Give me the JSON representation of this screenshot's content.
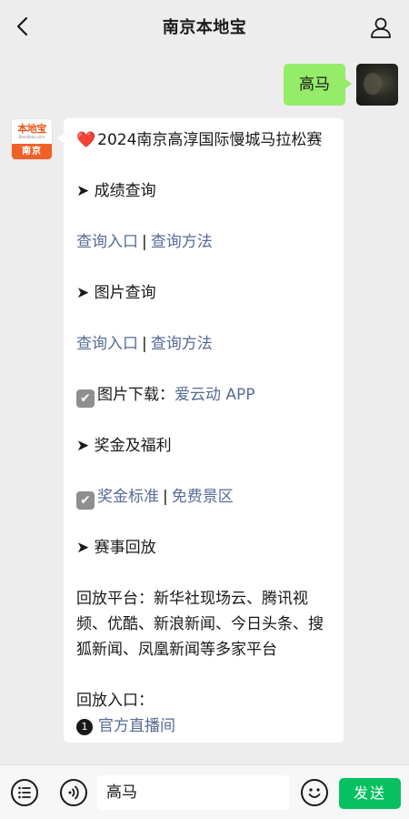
{
  "header": {
    "title": "南京本地宝",
    "back_icon": "chevron-left-icon",
    "user_icon": "person-icon"
  },
  "chat": {
    "outgoing": {
      "text": "高马"
    },
    "bot_avatar": {
      "logo": "本地宝",
      "url": "Bendibao.com",
      "city": "南京"
    },
    "incoming": {
      "title": "2024南京高淳国际慢城马拉松赛",
      "heart": "❤️",
      "sec_results": "➤ 成绩查询",
      "results_link1": "查询入口",
      "results_link2": "查询方法",
      "sec_photos": "➤ 图片查询",
      "photos_link1": "查询入口",
      "photos_link2": "查询方法",
      "download_label": "图片下载：",
      "download_link": "爱云动 APP",
      "sec_bonus": "➤ 奖金及福利",
      "bonus_link1": "奖金标准",
      "bonus_link2": "免费景区",
      "sec_replay": "➤ 赛事回放",
      "replay_platforms": "回放平台：新华社现场云、腾讯视频、优酷、新浪新闻、今日头条、搜狐新闻、凤凰新闻等多家平台",
      "replay_entry_label": "回放入口：",
      "replay_item_num": "1",
      "replay_item_link": "官方直播间",
      "separator": "|"
    }
  },
  "bottom_bar": {
    "input_value": "高马",
    "send_label": "发送"
  },
  "colors": {
    "background": "#ededed",
    "outgoing_bubble": "#95ec69",
    "link": "#576b95",
    "send_button": "#07c160",
    "brand_orange": "#f0612a"
  }
}
